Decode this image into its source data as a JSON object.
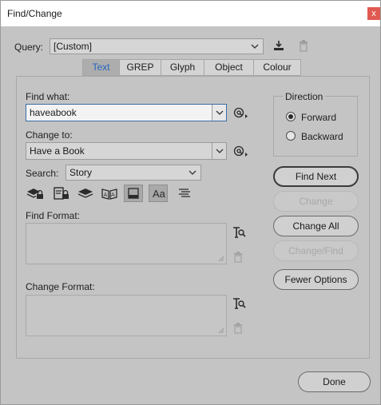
{
  "window": {
    "title": "Find/Change",
    "close_glyph": "x"
  },
  "query": {
    "label": "Query:",
    "value": "[Custom]"
  },
  "tabs": [
    {
      "label": "Text",
      "active": true
    },
    {
      "label": "GREP",
      "active": false
    },
    {
      "label": "Glyph",
      "active": false
    },
    {
      "label": "Object",
      "active": false
    },
    {
      "label": "Colour",
      "active": false
    }
  ],
  "find_what": {
    "label": "Find what:",
    "value": "haveabook"
  },
  "change_to": {
    "label": "Change to:",
    "value": "Have a Book"
  },
  "search": {
    "label": "Search:",
    "value": "Story"
  },
  "options_toggles": [
    {
      "icon": "include-locked-layers-icon",
      "on": false
    },
    {
      "icon": "include-locked-stories-icon",
      "on": false
    },
    {
      "icon": "include-hidden-layers-icon",
      "on": false
    },
    {
      "icon": "include-master-pages-icon",
      "on": false
    },
    {
      "icon": "include-footnotes-icon",
      "on": true
    },
    {
      "icon": "case-sensitive-icon",
      "on": true,
      "text": "Aa"
    },
    {
      "icon": "whole-word-icon",
      "on": false
    }
  ],
  "find_format": {
    "label": "Find Format:"
  },
  "change_format": {
    "label": "Change Format:"
  },
  "direction": {
    "label": "Direction",
    "options": [
      {
        "label": "Forward",
        "selected": true
      },
      {
        "label": "Backward",
        "selected": false
      }
    ]
  },
  "buttons": {
    "find_next": "Find Next",
    "change": "Change",
    "change_all": "Change All",
    "change_find": "Change/Find",
    "fewer_options": "Fewer Options",
    "done": "Done"
  },
  "colors": {
    "dialog_bg": "#c4c4c4",
    "active_tab_text": "#2568c2",
    "focus_border": "#3a6ea5",
    "close_button": "#e05a52"
  }
}
